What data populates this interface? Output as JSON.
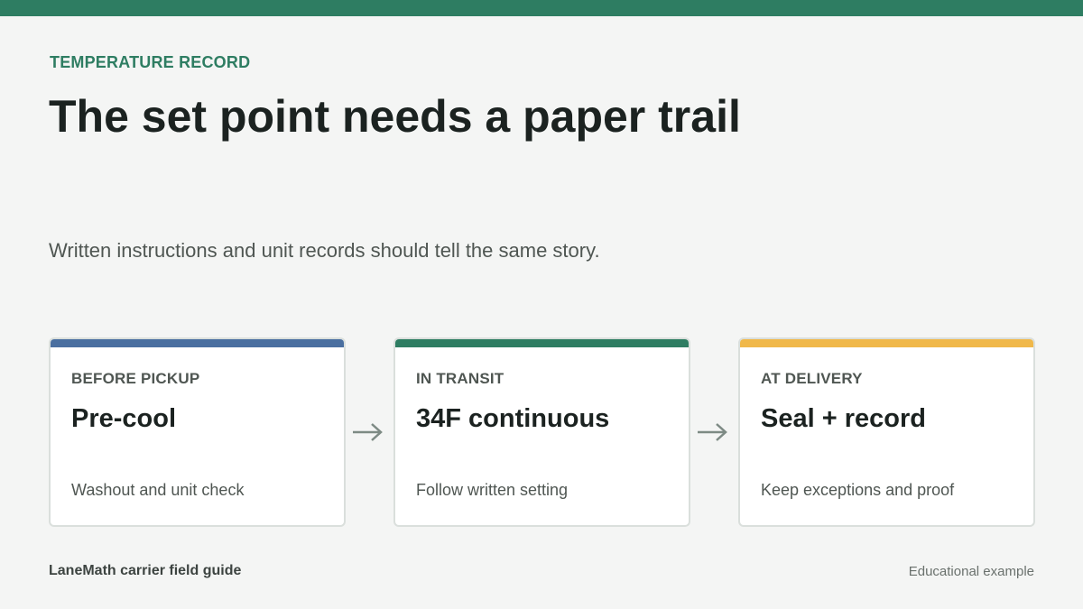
{
  "header": {
    "eyebrow": "TEMPERATURE RECORD",
    "title": "The set point needs a paper trail",
    "subtitle": "Written instructions and unit records should tell the same story."
  },
  "colors": {
    "brand": "#2e7d62",
    "before_pickup_accent": "#4a6fa0",
    "in_transit_accent": "#2e7d62",
    "at_delivery_accent": "#f0b84a"
  },
  "cards": [
    {
      "label": "BEFORE PICKUP",
      "value": "Pre-cool",
      "note": "Washout and unit check"
    },
    {
      "label": "IN TRANSIT",
      "value": "34F continuous",
      "note": "Follow written setting"
    },
    {
      "label": "AT DELIVERY",
      "value": "Seal + record",
      "note": "Keep exceptions and proof"
    }
  ],
  "icons": [
    "arrow-right-icon",
    "arrow-right-icon"
  ],
  "footer": {
    "source": "LaneMath carrier field guide",
    "disclaimer": "Educational example"
  }
}
